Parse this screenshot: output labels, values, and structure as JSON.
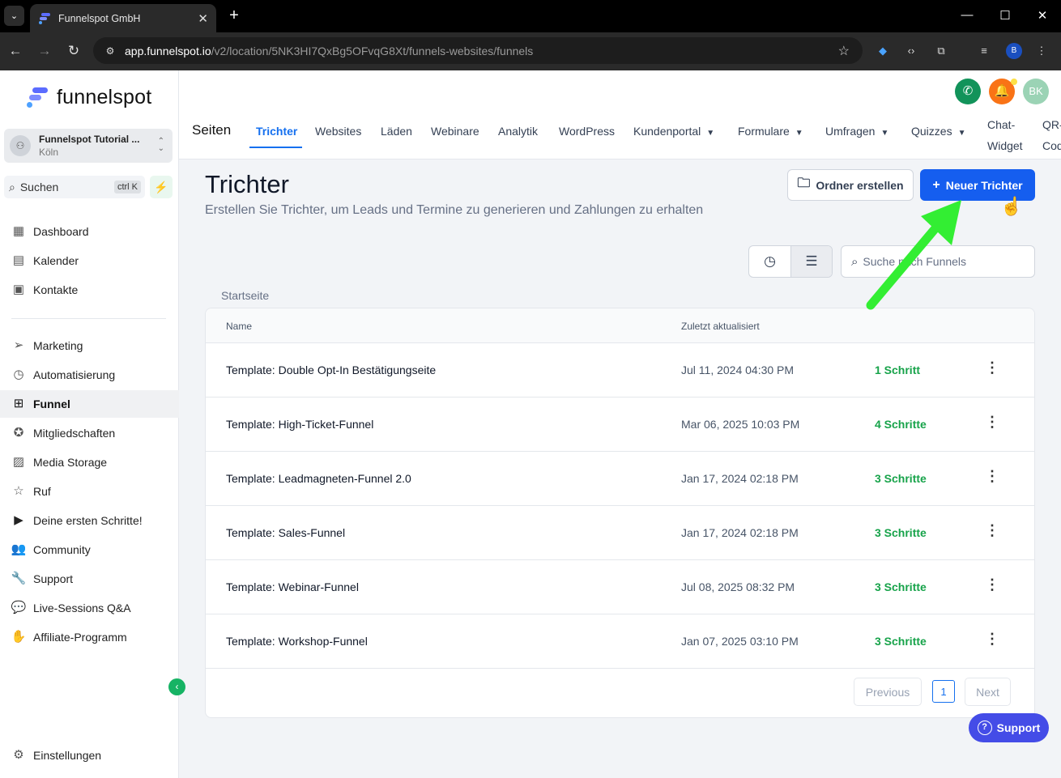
{
  "browser": {
    "tab_title": "Funnelspot GmbH",
    "url_host": "app.funnelspot.io",
    "url_path": "/v2/location/5NK3HI7QxBg5OFvqG8Xt/funnels-websites/funnels",
    "profile_initial": "B"
  },
  "sidebar": {
    "brand": "funnelspot",
    "location_name": "Funnelspot Tutorial ...",
    "location_city": "Köln",
    "search_label": "Suchen",
    "search_shortcut": "ctrl K",
    "items": [
      {
        "label": "Dashboard",
        "icon": "dashboard-icon"
      },
      {
        "label": "Kalender",
        "icon": "calendar-icon"
      },
      {
        "label": "Kontakte",
        "icon": "contacts-icon"
      },
      {
        "label": "Marketing",
        "icon": "send-icon"
      },
      {
        "label": "Automatisierung",
        "icon": "automation-icon"
      },
      {
        "label": "Funnel",
        "icon": "funnel-icon"
      },
      {
        "label": "Mitgliedschaften",
        "icon": "award-icon"
      },
      {
        "label": "Media Storage",
        "icon": "image-icon"
      },
      {
        "label": "Ruf",
        "icon": "star-icon"
      },
      {
        "label": "Deine ersten Schritte!",
        "icon": "play-icon"
      },
      {
        "label": "Community",
        "icon": "users-icon"
      },
      {
        "label": "Support",
        "icon": "wrench-icon"
      },
      {
        "label": "Live-Sessions Q&A",
        "icon": "chat-icon"
      },
      {
        "label": "Affiliate-Programm",
        "icon": "hand-coin-icon"
      }
    ],
    "settings_label": "Einstellungen"
  },
  "header": {
    "avatar_initials": "BK",
    "section_title": "Seiten",
    "tabs": [
      {
        "label": "Trichter"
      },
      {
        "label": "Websites"
      },
      {
        "label": "Läden"
      },
      {
        "label": "Webinare"
      },
      {
        "label": "Analytik"
      },
      {
        "label": "WordPress"
      },
      {
        "label": "Kundenportal"
      },
      {
        "label": "Formulare"
      },
      {
        "label": "Umfragen"
      },
      {
        "label": "Quizzes"
      },
      {
        "label": "Chat-"
      },
      {
        "label": "Widget"
      },
      {
        "label": "QR-"
      },
      {
        "label": "Cod"
      }
    ]
  },
  "main": {
    "title": "Trichter",
    "subtitle": "Erstellen Sie Trichter, um Leads und Termine zu generieren und Zahlungen zu erhalten",
    "create_folder_label": "Ordner erstellen",
    "new_funnel_label": "Neuer Trichter",
    "search_placeholder": "Suche nach Funnels",
    "breadcrumb": "Startseite",
    "table": {
      "columns": [
        "Name",
        "Zuletzt aktualisiert"
      ],
      "rows": [
        {
          "name": "Template: Double Opt-In Bestätigungseite",
          "updated": "Jul 11, 2024 04:30 PM",
          "steps": "1 Schritt"
        },
        {
          "name": "Template: High-Ticket-Funnel",
          "updated": "Mar 06, 2025 10:03 PM",
          "steps": "4 Schritte"
        },
        {
          "name": "Template: Leadmagneten-Funnel 2.0",
          "updated": "Jan 17, 2024 02:18 PM",
          "steps": "3 Schritte"
        },
        {
          "name": "Template: Sales-Funnel",
          "updated": "Jan 17, 2024 02:18 PM",
          "steps": "3 Schritte"
        },
        {
          "name": "Template: Webinar-Funnel",
          "updated": "Jul 08, 2025 08:32 PM",
          "steps": "3 Schritte"
        },
        {
          "name": "Template: Workshop-Funnel",
          "updated": "Jan 07, 2025 03:10 PM",
          "steps": "3 Schritte"
        }
      ]
    },
    "pagination": {
      "previous": "Previous",
      "page": "1",
      "next": "Next"
    },
    "support_label": "Support"
  },
  "colors": {
    "primary": "#155eef",
    "success": "#17a34a",
    "annotation_arrow": "#33ee33"
  }
}
